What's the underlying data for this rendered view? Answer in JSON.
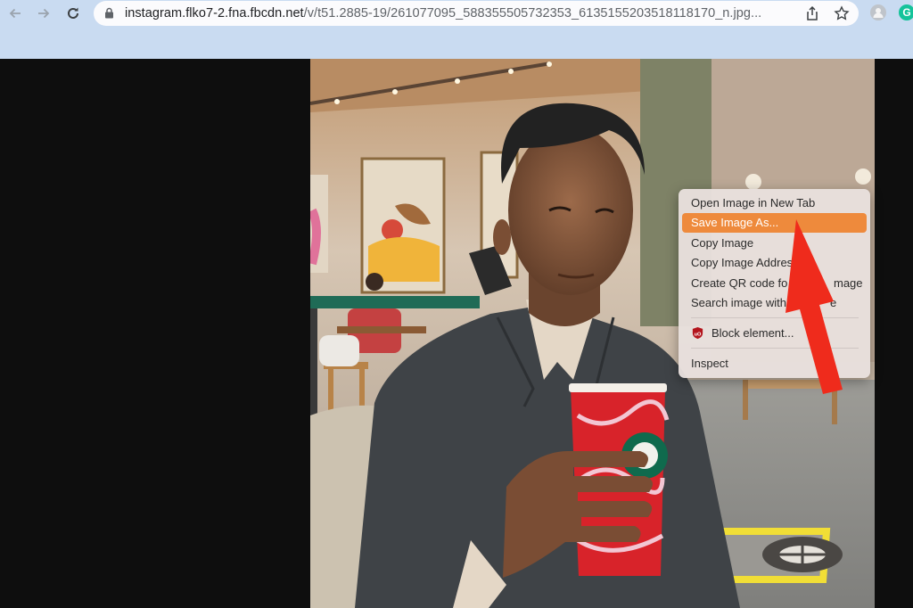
{
  "browser": {
    "nav": {
      "back_icon": "arrow-left-icon",
      "forward_icon": "arrow-right-icon",
      "reload_icon": "reload-icon"
    },
    "omnibox": {
      "security_icon": "lock-icon",
      "url_host": "instagram.flko7-2.fna.fbcdn.net",
      "url_path": "/v/t51.2885-19/261077095_588355505732353_6135155203518118170_n.jpg...",
      "share_icon": "share-icon",
      "bookmark_icon": "star-icon"
    },
    "toolbar_right": {
      "profile_icon": "profile-avatar-icon",
      "extension_icon": "grammarly-extension-icon",
      "extension_letter": "G"
    },
    "colors": {
      "toolbar_bg": "#c9dbf1",
      "page_bg": "#0e0e0e",
      "menu_highlight": "#ee8a3c",
      "annotation_arrow": "#ef2b1c"
    }
  },
  "page": {
    "image_description": "Man in dark blazer holding red Starbucks holiday cup inside a cafe"
  },
  "context_menu": {
    "items": [
      {
        "label": "Open Image in New Tab",
        "highlighted": false
      },
      {
        "label": "Save Image As...",
        "highlighted": true
      },
      {
        "label": "Copy Image",
        "highlighted": false
      },
      {
        "label": "Copy Image Addres",
        "highlighted": false
      },
      {
        "label": "Create QR code fo",
        "label_tail": "mage",
        "highlighted": false
      },
      {
        "label": "Search image with",
        "label_tail": "e",
        "highlighted": false
      },
      {
        "label": "Block element...",
        "icon": "ublock-origin-icon",
        "highlighted": false
      },
      {
        "label": "Inspect",
        "highlighted": false
      }
    ]
  },
  "annotation": {
    "type": "red-arrow",
    "points_to": "Save Image As..."
  }
}
